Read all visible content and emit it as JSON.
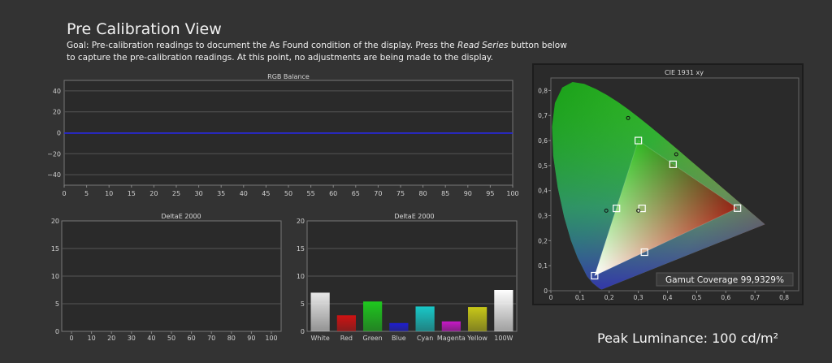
{
  "header": {
    "title": "Pre Calibration View",
    "goal_part1": "Goal: Pre-calibration readings to document the As Found condition of the display. Press the ",
    "goal_em": "Read Series",
    "goal_part2": " button below to capture the pre-calibration readings. At this point, no adjustments are being made to the display."
  },
  "rgb_chart": {
    "title": "RGB Balance",
    "x_ticks": [
      "0",
      "5",
      "10",
      "15",
      "20",
      "25",
      "30",
      "35",
      "40",
      "45",
      "50",
      "55",
      "60",
      "65",
      "70",
      "75",
      "80",
      "85",
      "90",
      "95",
      "100"
    ],
    "y_ticks": [
      "40",
      "20",
      "0",
      "−20",
      "−40"
    ],
    "line_color": "#2222ee"
  },
  "delta_left": {
    "title": "DeltaE 2000",
    "x_ticks": [
      "0",
      "10",
      "20",
      "30",
      "40",
      "50",
      "60",
      "70",
      "80",
      "90",
      "100"
    ],
    "y_ticks": [
      "20",
      "15",
      "10",
      "5",
      "0"
    ]
  },
  "chart_data": {
    "type": "bar",
    "title": "DeltaE 2000",
    "categories": [
      "White",
      "Red",
      "Green",
      "Blue",
      "Cyan",
      "Magenta",
      "Yellow",
      "100W"
    ],
    "values": [
      7.0,
      2.9,
      5.4,
      1.5,
      4.5,
      1.8,
      4.4,
      7.5
    ],
    "colors": [
      "#e8e8e8",
      "#d01212",
      "#1ec81e",
      "#1e1ed2",
      "#18c8c8",
      "#c818c8",
      "#c8c818",
      "#ffffff"
    ],
    "ylim": [
      0,
      20
    ],
    "y_ticks": [
      "20",
      "15",
      "10",
      "5",
      "0"
    ]
  },
  "cie": {
    "title": "CIE 1931 xy",
    "x_ticks": [
      "0",
      "0,1",
      "0,2",
      "0,3",
      "0,4",
      "0,5",
      "0,6",
      "0,7",
      "0,8"
    ],
    "y_ticks": [
      "0,8",
      "0,7",
      "0,6",
      "0,5",
      "0,4",
      "0,3",
      "0,2",
      "0,1",
      "0"
    ],
    "gamut_label": "Gamut Coverage 99,9329%",
    "targets": [
      {
        "x": 0.64,
        "y": 0.33
      },
      {
        "x": 0.3,
        "y": 0.6
      },
      {
        "x": 0.15,
        "y": 0.06
      },
      {
        "x": 0.225,
        "y": 0.329
      },
      {
        "x": 0.321,
        "y": 0.154
      },
      {
        "x": 0.419,
        "y": 0.505
      },
      {
        "x": 0.3127,
        "y": 0.329
      }
    ],
    "measured": [
      {
        "x": 0.265,
        "y": 0.69
      },
      {
        "x": 0.43,
        "y": 0.545
      },
      {
        "x": 0.19,
        "y": 0.32
      },
      {
        "x": 0.3,
        "y": 0.32
      }
    ]
  },
  "peak": {
    "label": "Peak Luminance: 100 cd/m²"
  }
}
